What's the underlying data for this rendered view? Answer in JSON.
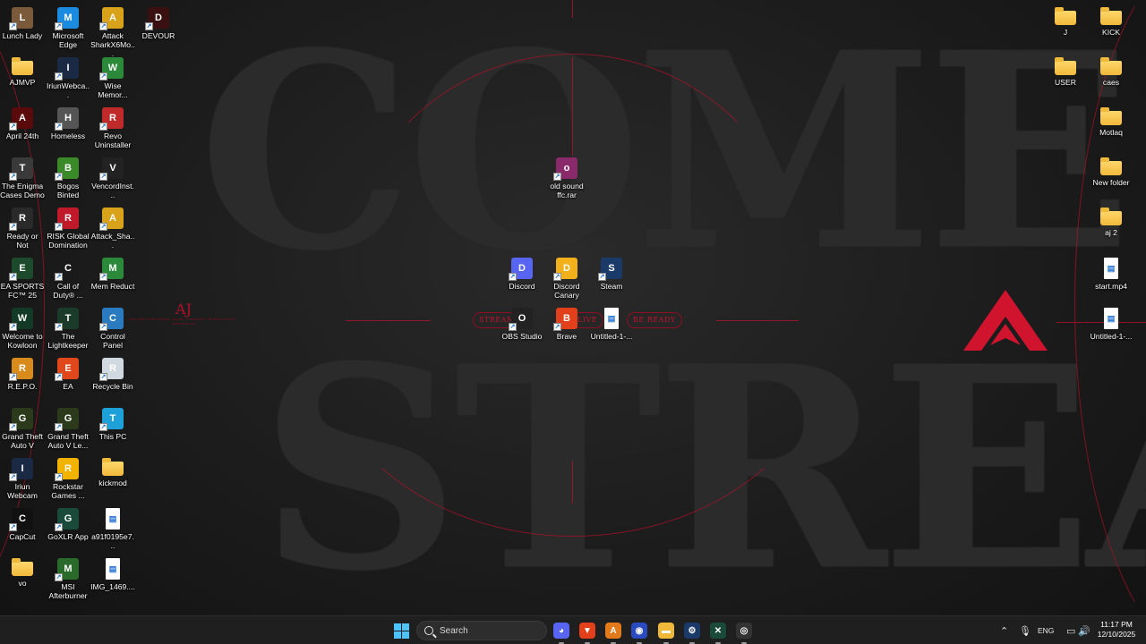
{
  "wallpaper": {
    "headline_top": "COME",
    "headline_bottom": "STREA",
    "tag_streamer": "STREAMER",
    "tag_live": "LIVE",
    "tag_ready": "BE READY",
    "aj_title": "AJ",
    "aj_subtitle": "WELCOME TO THE STREAM · GAMING · COMMUNITY · BE READY FOR ALL · STREAMER LIFE",
    "accent_color": "#c0142e"
  },
  "desktop": {
    "col1": [
      {
        "label": "Lunch Lady",
        "icon": "lunch-lady-game-icon",
        "color": "#7a5a3a"
      },
      {
        "label": "AJMVP",
        "icon": "folder-icon",
        "type": "folder"
      },
      {
        "label": "April 24th",
        "icon": "april-24th-game-icon",
        "color": "#5a0a0a"
      },
      {
        "label": "The Enigma Cases Demo",
        "icon": "enigma-cases-icon",
        "color": "#3a3a3a"
      },
      {
        "label": "Ready or Not",
        "icon": "ready-or-not-icon",
        "color": "#2a2a2a"
      },
      {
        "label": "EA SPORTS FC™ 25",
        "icon": "ea-fc25-icon",
        "color": "#1c4a2a"
      },
      {
        "label": "Welcome to Kowloon",
        "icon": "kowloon-icon",
        "color": "#123a26"
      },
      {
        "label": "R.E.P.O.",
        "icon": "repo-icon",
        "color": "#d88a1a"
      },
      {
        "label": "Grand Theft Auto V",
        "icon": "gta-v-icon",
        "color": "#2a3a1a"
      },
      {
        "label": "Iriun Webcam",
        "icon": "iriun-webcam-icon",
        "color": "#1a2a44"
      },
      {
        "label": "CapCut",
        "icon": "capcut-icon",
        "color": "#111111"
      },
      {
        "label": "vo",
        "icon": "folder-icon",
        "type": "folder"
      }
    ],
    "col2": [
      {
        "label": "Microsoft Edge",
        "icon": "edge-icon",
        "color": "#1b8be0"
      },
      {
        "label": "IriunWebca...",
        "icon": "iriun-webcam-icon",
        "color": "#1a2a44"
      },
      {
        "label": "Homeless",
        "icon": "homeless-game-icon",
        "color": "#555555"
      },
      {
        "label": "Bogos Binted",
        "icon": "bogos-binted-icon",
        "color": "#3a8a2a"
      },
      {
        "label": "RISK Global Domination",
        "icon": "risk-icon",
        "color": "#c01a2a"
      },
      {
        "label": "Call of Duty® ...",
        "icon": "call-of-duty-icon",
        "color": "#1a1a1a"
      },
      {
        "label": "The Lightkeeper",
        "icon": "lightkeeper-icon",
        "color": "#1a3a2a"
      },
      {
        "label": "EA",
        "icon": "ea-icon",
        "color": "#e0471a"
      },
      {
        "label": "Grand Theft Auto V Le...",
        "icon": "gta-v-legacy-icon",
        "color": "#2a3a1a"
      },
      {
        "label": "Rockstar Games ...",
        "icon": "rockstar-icon",
        "color": "#f2b200"
      },
      {
        "label": "GoXLR App",
        "icon": "goxlr-icon",
        "color": "#1a4a3a"
      },
      {
        "label": "MSI Afterburner",
        "icon": "msi-afterburner-icon",
        "color": "#2a6a2a"
      }
    ],
    "col3": [
      {
        "label": "Attack SharkX6Mo...",
        "icon": "attack-shark-icon",
        "color": "#d8a21a"
      },
      {
        "label": "Wise Memor...",
        "icon": "wise-memory-icon",
        "color": "#2a8a3a"
      },
      {
        "label": "Revo Uninstaller",
        "icon": "revo-uninstaller-icon",
        "color": "#c02a2a"
      },
      {
        "label": "VencordInst...",
        "icon": "vencord-icon",
        "color": "#222222"
      },
      {
        "label": "Attack_Sha...",
        "icon": "attack-shark-icon",
        "color": "#d8a21a"
      },
      {
        "label": "Mem Reduct",
        "icon": "mem-reduct-icon",
        "color": "#2a8a3a"
      },
      {
        "label": "Control Panel",
        "icon": "control-panel-icon",
        "color": "#2a7ac0"
      },
      {
        "label": "Recycle Bin",
        "icon": "recycle-bin-icon",
        "color": "#d0d8e0"
      },
      {
        "label": "This PC",
        "icon": "this-pc-icon",
        "color": "#1ea0d8"
      },
      {
        "label": "kickmod",
        "icon": "folder-icon",
        "type": "folder"
      },
      {
        "label": "a91f0195e7...",
        "icon": "image-file-icon",
        "type": "file"
      },
      {
        "label": "IMG_1469....",
        "icon": "image-file-icon",
        "type": "file"
      }
    ],
    "col4": [
      {
        "label": "DEVOUR",
        "icon": "devour-icon",
        "color": "#3a1010"
      }
    ],
    "center": [
      {
        "label": "old sound ffc.rar",
        "icon": "winrar-archive-icon",
        "color": "#8a2a6a"
      },
      {
        "label": "Discord",
        "icon": "discord-icon",
        "color": "#5865f2"
      },
      {
        "label": "Discord Canary",
        "icon": "discord-canary-icon",
        "color": "#f2b01a"
      },
      {
        "label": "Steam",
        "icon": "steam-icon",
        "color": "#1a3a6a"
      },
      {
        "label": "OBS Studio",
        "icon": "obs-icon",
        "color": "#222222"
      },
      {
        "label": "Brave",
        "icon": "brave-icon",
        "color": "#e2401a"
      },
      {
        "label": "Untitled-1-...",
        "icon": "image-file-icon",
        "type": "file"
      }
    ],
    "right_col1": [
      {
        "label": "J",
        "icon": "folder-icon",
        "type": "folder"
      },
      {
        "label": "USER",
        "icon": "folder-icon",
        "type": "folder"
      }
    ],
    "right_col2": [
      {
        "label": "KICK",
        "icon": "folder-icon",
        "type": "folder"
      },
      {
        "label": "caes",
        "icon": "folder-icon",
        "type": "folder"
      },
      {
        "label": "Motlaq",
        "icon": "folder-icon",
        "type": "folder"
      },
      {
        "label": "New folder",
        "icon": "folder-icon",
        "type": "folder"
      },
      {
        "label": "aj 2",
        "icon": "folder-icon",
        "type": "folder"
      },
      {
        "label": "start.mp4",
        "icon": "video-file-icon",
        "type": "file"
      },
      {
        "label": "Untitled-1-...",
        "icon": "image-file-icon",
        "type": "file"
      }
    ]
  },
  "taskbar": {
    "search_placeholder": "Search",
    "apps": [
      {
        "name": "discord",
        "icon": "discord-icon",
        "color": "#5865f2",
        "glyph": "◕"
      },
      {
        "name": "brave",
        "icon": "brave-icon",
        "color": "#e2401a",
        "glyph": "▼"
      },
      {
        "name": "attack-shark",
        "icon": "attack-shark-icon",
        "color": "#e07a1a",
        "glyph": "A"
      },
      {
        "name": "iriun-webcam",
        "icon": "iriun-webcam-icon",
        "color": "#2a4ac0",
        "glyph": "◉"
      },
      {
        "name": "file-explorer",
        "icon": "file-explorer-icon",
        "color": "#f0b93a",
        "glyph": "▬"
      },
      {
        "name": "steam",
        "icon": "steam-icon",
        "color": "#1a3a6a",
        "glyph": "⚙"
      },
      {
        "name": "goxlr",
        "icon": "goxlr-icon",
        "color": "#1a4a3a",
        "glyph": "✕"
      },
      {
        "name": "obs",
        "icon": "obs-icon",
        "color": "#333333",
        "glyph": "◎"
      }
    ],
    "tray": {
      "language": "ENG",
      "time": "11:17 PM",
      "date": "12/10/2025"
    }
  }
}
